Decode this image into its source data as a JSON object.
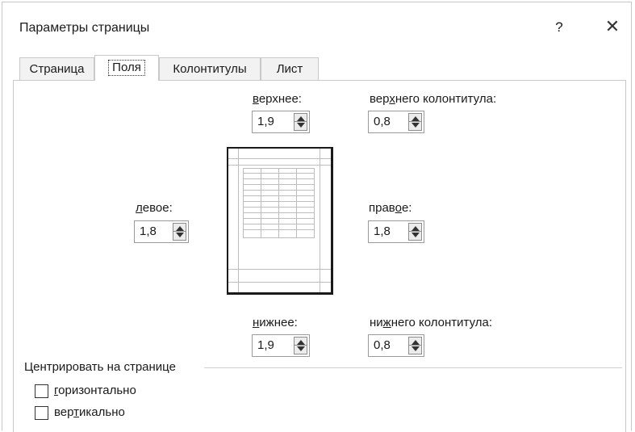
{
  "dialog": {
    "title": "Параметры страницы",
    "help": "?",
    "close": "✕"
  },
  "tabs": [
    {
      "label": "Страница",
      "active": false
    },
    {
      "label": "Поля",
      "active": true
    },
    {
      "label": "Колонтитулы",
      "active": false
    },
    {
      "label": "Лист",
      "active": false
    }
  ],
  "margins": {
    "top": {
      "label_pre": "",
      "label_u": "в",
      "label_post": "ерхнее:",
      "value": "1,9"
    },
    "header": {
      "label_pre": "вер",
      "label_u": "х",
      "label_post": "него колонтитула:",
      "value": "0,8"
    },
    "left": {
      "label_pre": "",
      "label_u": "л",
      "label_post": "евое:",
      "value": "1,8"
    },
    "right": {
      "label_pre": "прав",
      "label_u": "о",
      "label_post": "е:",
      "value": "1,8"
    },
    "bottom": {
      "label_pre": "",
      "label_u": "н",
      "label_post": "ижнее:",
      "value": "1,9"
    },
    "footer": {
      "label_pre": "ни",
      "label_u": "ж",
      "label_post": "него колонтитула:",
      "value": "0,8"
    }
  },
  "center": {
    "title": "Центрировать на странице",
    "horizontal": {
      "label_u": "г",
      "label_post": "оризонтально",
      "checked": false
    },
    "vertical": {
      "label_pre": "вер",
      "label_u": "т",
      "label_post": "икально",
      "checked": false
    }
  }
}
